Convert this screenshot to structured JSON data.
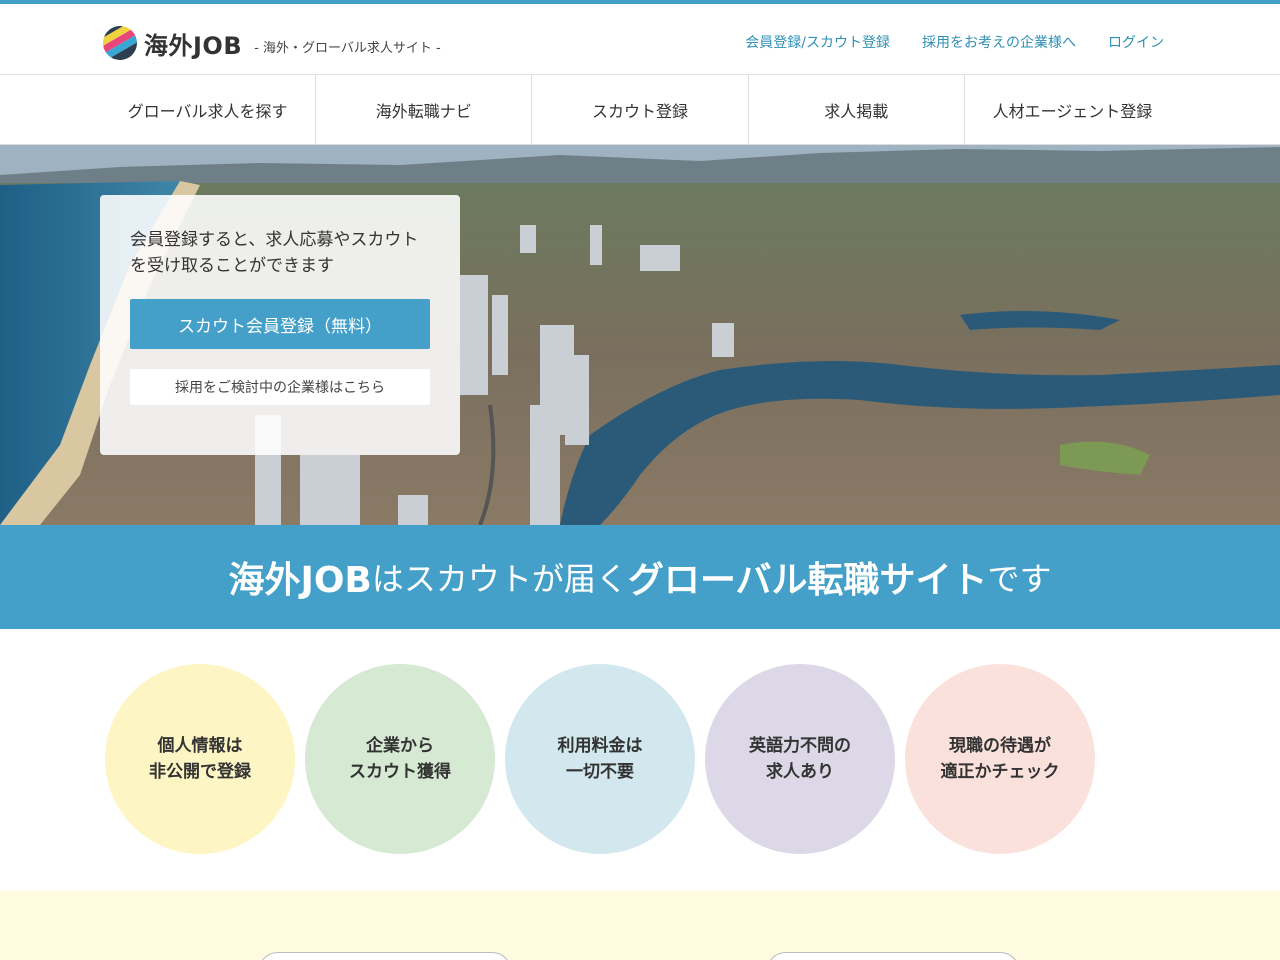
{
  "header": {
    "logo_text": "海外JOB",
    "tagline": "- 海外・グローバル求人サイト -",
    "links": [
      "会員登録/スカウト登録",
      "採用をお考えの企業様へ",
      "ログイン"
    ]
  },
  "nav": {
    "items": [
      "グローバル求人を探す",
      "海外転職ナビ",
      "スカウト登録",
      "求人掲載",
      "人材エージェント登録"
    ]
  },
  "hero": {
    "text": "会員登録すると、求人応募やスカウトを受け取ることができます",
    "primary_button": "スカウト会員登録（無料）",
    "secondary_button": "採用をご検討中の企業様はこちら"
  },
  "banner": {
    "part1": "海外JOB",
    "part2": "はスカウトが届く",
    "part3": "グローバル転職サイト",
    "part4": "です"
  },
  "features": [
    {
      "line1": "個人情報は",
      "line2": "非公開で登録",
      "color": "#fdf5c4"
    },
    {
      "line1": "企業から",
      "line2": "スカウト獲得",
      "color": "#d5e9d3"
    },
    {
      "line1": "利用料金は",
      "line2": "一切不要",
      "color": "#d2e8ee"
    },
    {
      "line1": "英語力不問の",
      "line2": "求人あり",
      "color": "#ddd8e8"
    },
    {
      "line1": "現職の待遇が",
      "line2": "適正かチェック",
      "color": "#fbe1dc"
    }
  ],
  "colors": {
    "accent": "#44a0c8",
    "link": "#2f8fb5"
  }
}
